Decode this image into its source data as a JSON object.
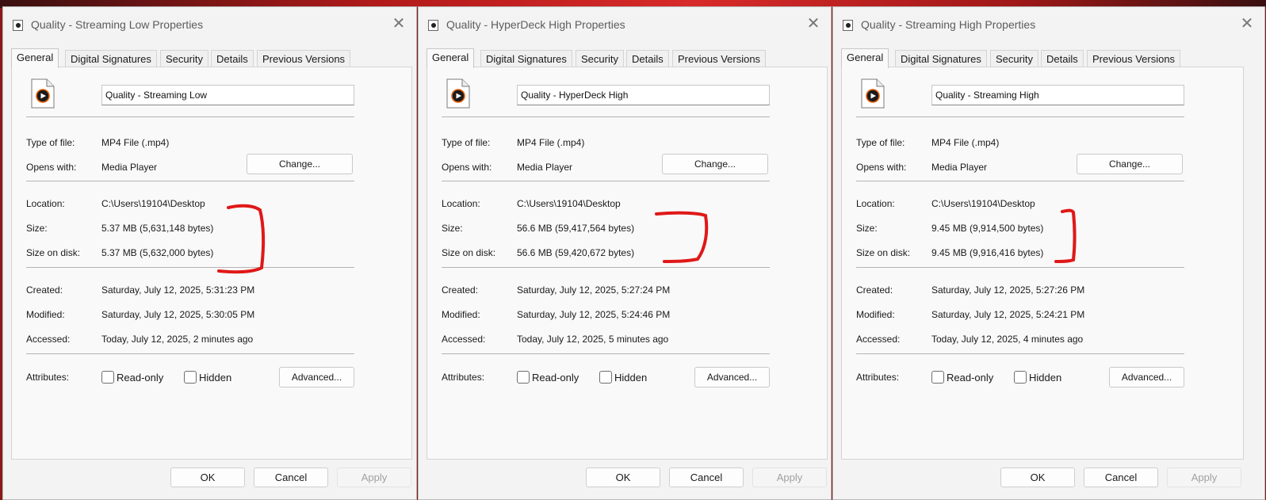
{
  "dialogs": [
    {
      "title": "Quality - Streaming Low Properties",
      "tabs": [
        "General",
        "Digital Signatures",
        "Security",
        "Details",
        "Previous Versions"
      ],
      "file_name": "Quality - Streaming Low",
      "type_label": "Type of file:",
      "type_value": "MP4 File (.mp4)",
      "opens_label": "Opens with:",
      "opens_value": "Media Player",
      "change_label": "Change...",
      "location_label": "Location:",
      "location_value": "C:\\Users\\19104\\Desktop",
      "size_label": "Size:",
      "size_value": "5.37 MB (5,631,148 bytes)",
      "disk_label": "Size on disk:",
      "disk_value": "5.37 MB (5,632,000 bytes)",
      "created_label": "Created:",
      "created_value": "Saturday, July 12, 2025, 5:31:23 PM",
      "modified_label": "Modified:",
      "modified_value": "Saturday, July 12, 2025, 5:30:05 PM",
      "accessed_label": "Accessed:",
      "accessed_value": "Today, July 12, 2025, 2 minutes ago",
      "attributes_label": "Attributes:",
      "readonly_label": "Read-only",
      "hidden_label": "Hidden",
      "advanced_label": "Advanced...",
      "ok_label": "OK",
      "cancel_label": "Cancel",
      "apply_label": "Apply"
    },
    {
      "title": "Quality - HyperDeck High Properties",
      "tabs": [
        "General",
        "Digital Signatures",
        "Security",
        "Details",
        "Previous Versions"
      ],
      "file_name": "Quality - HyperDeck High",
      "type_label": "Type of file:",
      "type_value": "MP4 File (.mp4)",
      "opens_label": "Opens with:",
      "opens_value": "Media Player",
      "change_label": "Change...",
      "location_label": "Location:",
      "location_value": "C:\\Users\\19104\\Desktop",
      "size_label": "Size:",
      "size_value": "56.6 MB (59,417,564 bytes)",
      "disk_label": "Size on disk:",
      "disk_value": "56.6 MB (59,420,672 bytes)",
      "created_label": "Created:",
      "created_value": "Saturday, July 12, 2025, 5:27:24 PM",
      "modified_label": "Modified:",
      "modified_value": "Saturday, July 12, 2025, 5:24:46 PM",
      "accessed_label": "Accessed:",
      "accessed_value": "Today, July 12, 2025, 5 minutes ago",
      "attributes_label": "Attributes:",
      "readonly_label": "Read-only",
      "hidden_label": "Hidden",
      "advanced_label": "Advanced...",
      "ok_label": "OK",
      "cancel_label": "Cancel",
      "apply_label": "Apply"
    },
    {
      "title": "Quality - Streaming High Properties",
      "tabs": [
        "General",
        "Digital Signatures",
        "Security",
        "Details",
        "Previous Versions"
      ],
      "file_name": "Quality - Streaming High",
      "type_label": "Type of file:",
      "type_value": "MP4 File (.mp4)",
      "opens_label": "Opens with:",
      "opens_value": "Media Player",
      "change_label": "Change...",
      "location_label": "Location:",
      "location_value": "C:\\Users\\19104\\Desktop",
      "size_label": "Size:",
      "size_value": "9.45 MB (9,914,500 bytes)",
      "disk_label": "Size on disk:",
      "disk_value": "9.45 MB (9,916,416 bytes)",
      "created_label": "Created:",
      "created_value": "Saturday, July 12, 2025, 5:27:26 PM",
      "modified_label": "Modified:",
      "modified_value": "Saturday, July 12, 2025, 5:24:21 PM",
      "accessed_label": "Accessed:",
      "accessed_value": "Today, July 12, 2025, 4 minutes ago",
      "attributes_label": "Attributes:",
      "readonly_label": "Read-only",
      "hidden_label": "Hidden",
      "advanced_label": "Advanced...",
      "ok_label": "OK",
      "cancel_label": "Cancel",
      "apply_label": "Apply"
    }
  ],
  "icons": {
    "title": "media-file-icon",
    "close": "close-icon",
    "file": "mp4-file-icon"
  },
  "colors": {
    "annotation": "#e01818",
    "play_ring": "#e8620a"
  },
  "checkboxes": {
    "readonly_checked": false,
    "hidden_checked": false
  }
}
